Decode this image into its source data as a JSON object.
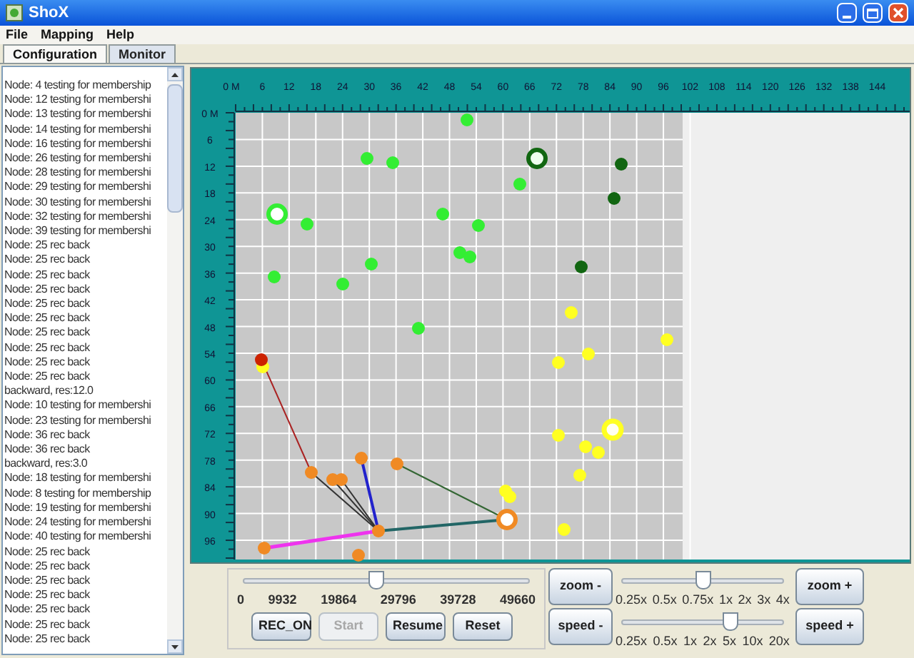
{
  "window": {
    "title": "ShoX"
  },
  "menu": [
    "File",
    "Mapping",
    "Help"
  ],
  "tabs": [
    {
      "label": "Configuration",
      "selected": true
    },
    {
      "label": "Monitor",
      "selected": false
    }
  ],
  "log": {
    "lines": [
      "Node: 4 testing for membership",
      "Node: 12 testing for membershi",
      "Node: 13 testing for membershi",
      "Node: 14 testing for membershi",
      "Node: 16 testing for membershi",
      "Node: 26 testing for membershi",
      "Node: 28 testing for membershi",
      "Node: 29 testing for membershi",
      "Node: 30 testing for membershi",
      "Node: 32 testing for membershi",
      "Node: 39 testing for membershi",
      "Node: 25 rec back",
      "Node: 25 rec back",
      "Node: 25 rec back",
      "Node: 25 rec back",
      "Node: 25 rec back",
      "Node: 25 rec back",
      "Node: 25 rec back",
      "Node: 25 rec back",
      "Node: 25 rec back",
      "Node: 25 rec back",
      "backward, res:12.0",
      "Node: 10 testing for membershi",
      "Node: 23 testing for membershi",
      "Node: 36 rec back",
      "Node: 36 rec back",
      "backward, res:3.0",
      "Node: 18 testing for membershi",
      "Node: 8 testing for membership",
      "Node: 19 testing for membershi",
      "Node: 24 testing for membershi",
      "Node: 40 testing for membershi",
      "Node: 25 rec back",
      "Node: 25 rec back",
      "Node: 25 rec back",
      "Node: 25 rec back",
      "Node: 25 rec back",
      "Node: 25 rec back",
      "Node: 25 rec back"
    ]
  },
  "map": {
    "x_ticks": [
      "0 M",
      "6",
      "12",
      "18",
      "24",
      "30",
      "36",
      "42",
      "48",
      "54",
      "60",
      "66",
      "72",
      "78",
      "84",
      "90",
      "96",
      "102",
      "108",
      "114",
      "120",
      "126",
      "132",
      "138",
      "144"
    ],
    "y_ticks": [
      "0 M",
      "6",
      "12",
      "18",
      "24",
      "30",
      "36",
      "42",
      "48",
      "54",
      "60",
      "66",
      "72",
      "78",
      "84",
      "90",
      "96"
    ]
  },
  "timeline": {
    "level": 0.46,
    "ticks": [
      "0",
      "9932",
      "19864",
      "29796",
      "39728",
      "49660"
    ],
    "buttons": [
      {
        "label": "REC_ON",
        "disabled": false
      },
      {
        "label": "Start",
        "disabled": true
      },
      {
        "label": "Resume",
        "disabled": false
      },
      {
        "label": "Reset",
        "disabled": false
      }
    ]
  },
  "zoom": {
    "minus": "zoom -",
    "plus": "zoom +",
    "level": 0.5,
    "ticks": [
      "0.25x",
      "0.5x",
      "0.75x",
      "1x",
      "2x",
      "3x",
      "4x"
    ]
  },
  "speed": {
    "minus": "speed -",
    "plus": "speed +",
    "level": 0.67,
    "ticks": [
      "0.25x",
      "0.5x",
      "1x",
      "2x",
      "5x",
      "10x",
      "20x"
    ]
  }
}
